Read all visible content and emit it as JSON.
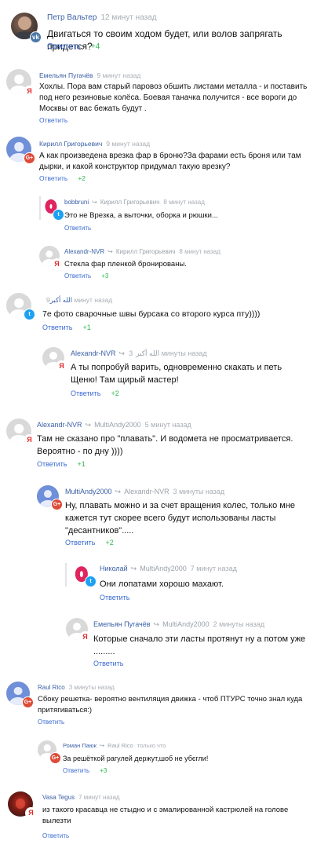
{
  "ui": {
    "answer_label": "Ответить"
  },
  "comments": [
    {
      "author": "Петр Вальтер",
      "reply_to": "",
      "time": "12 минут назад",
      "text": "Двигаться то своим ходом будет, или волов запрягать придется?",
      "votes": "+4",
      "avatar": "photo",
      "badge": "vk-icon"
    },
    {
      "author": "Емельян Пугачёв",
      "reply_to": "",
      "time": "9 минут назад",
      "text": "Хохлы. Пора вам старый паровоз обшить листами металла - и поставить под него резиновые колёса. Боевая таначка получится - все вороги до Москвы от вас бежать будут .",
      "votes": "",
      "avatar": "gray",
      "badge": "yandex-icon"
    },
    {
      "author": "Кирилл Григорьевич",
      "reply_to": "",
      "time": "9 минут назад",
      "text": "А как произведена врезка фар в броню?За фарами есть броня или там дырки, и какой конструктор придумал такую врезку?",
      "votes": "+2",
      "avatar": "blue",
      "badge": "google-plus-icon"
    },
    {
      "author": "bobbruni",
      "reply_to": "Кирилл Григорьевич",
      "time": "8 минут назад",
      "text": "Это не Врезка, а выточки, оборка и рюшки...",
      "votes": "",
      "avatar": "ring",
      "badge": "twitter-icon"
    },
    {
      "author": "Alexandr-NVR",
      "reply_to": "Кирилл Григорьевич",
      "time": "8 минут назад",
      "text": "Стекла фар пленкой бронированы.",
      "votes": "+3",
      "avatar": "gray",
      "badge": "yandex-icon"
    },
    {
      "author": "الله أكبر",
      "reply_to": "",
      "time": "9 минут назад",
      "text": "7е фото сварочные швы бурсака со второго курса пту))))",
      "votes": "+1",
      "avatar": "gray",
      "badge": "twitter-icon"
    },
    {
      "author": "Alexandr-NVR",
      "reply_to": "الله أكبر",
      "time": "3 минуты назад",
      "text": "А ты попробуй варить, одновременно скакать и петь Щеню! Там щирый мастер!",
      "votes": "+2",
      "avatar": "gray",
      "badge": "yandex-icon"
    },
    {
      "author": "Alexandr-NVR",
      "reply_to": "MultiAndy2000",
      "time": "5 минут назад",
      "text": "Там не сказано про \"плавать\". И водомета не просматривается. Вероятно - по дну ))))",
      "votes": "+1",
      "avatar": "gray",
      "badge": "yandex-icon"
    },
    {
      "author": "MultiAndy2000",
      "reply_to": "Alexandr-NVR",
      "time": "3 минуты назад",
      "text": "Ну, плавать можно и за счет вращения колес, только мне кажется тут скорее всего будут использованы ласты \"десантников\".....",
      "votes": "+2",
      "avatar": "blue",
      "badge": "google-plus-icon"
    },
    {
      "author": "Николай",
      "reply_to": "MultiAndy2000",
      "time": "7 минут назад",
      "text": "Они лопатами хорошо махают.",
      "votes": "",
      "avatar": "ring",
      "badge": "twitter-icon"
    },
    {
      "author": "Емельян Пугачёв",
      "reply_to": "MultiAndy2000",
      "time": "2 минуты назад",
      "text": "Которые сначало эти ласты протянут ну а потом уже .........",
      "votes": "",
      "avatar": "gray",
      "badge": "yandex-icon"
    },
    {
      "author": "Raul Rico",
      "reply_to": "",
      "time": "3 минуты назад",
      "text": "Сбоку решетка- вероятно вентиляция движка - чтоб ПТУРС точно знал куда притягиваться:)",
      "votes": "",
      "avatar": "blue",
      "badge": "google-plus-icon"
    },
    {
      "author": "Роман Паюк",
      "reply_to": "Raul Rico",
      "time": "только что",
      "text": "За решёткой рагулей держут,шоб не убєгли!",
      "votes": "+3",
      "avatar": "gray",
      "badge": "google-plus-icon"
    },
    {
      "author": "Vasa Tegus",
      "reply_to": "",
      "time": "7 минут назад",
      "text": "из такого красавца не стыдно и с эмалированной кастрюлей на голове вылезти",
      "votes": "",
      "avatar": "dark",
      "badge": "yandex-icon"
    }
  ]
}
